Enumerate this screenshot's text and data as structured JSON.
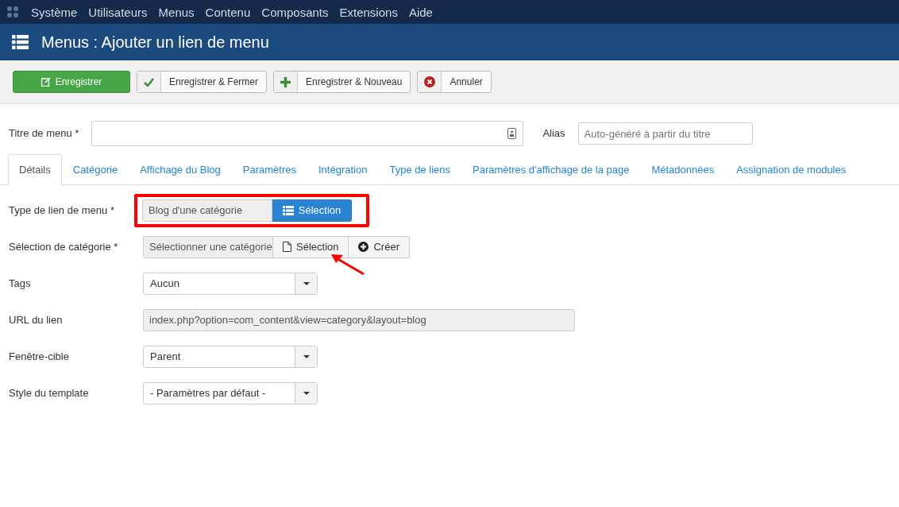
{
  "menubar": [
    "Système",
    "Utilisateurs",
    "Menus",
    "Contenu",
    "Composants",
    "Extensions",
    "Aide"
  ],
  "header": {
    "title": "Menus : Ajouter un lien de menu"
  },
  "toolbar": [
    {
      "label": "Enregistrer",
      "kind": "primary"
    },
    {
      "label": "Enregistrer & Fermer",
      "kind": "default"
    },
    {
      "label": "Enregistrer & Nouveau",
      "kind": "default"
    },
    {
      "label": "Annuler",
      "kind": "default"
    }
  ],
  "title_field": {
    "label": "Titre de menu *"
  },
  "alias_field": {
    "label": "Alias",
    "placeholder": "Auto-généré à partir du titre"
  },
  "tabs": [
    {
      "label": "Détails",
      "selected": true
    },
    {
      "label": "Catégorie",
      "selected": false
    },
    {
      "label": "Affichage du Blog",
      "selected": false
    },
    {
      "label": "Paramètres",
      "selected": false
    },
    {
      "label": "Intégration",
      "selected": false
    },
    {
      "label": "Type de liens",
      "selected": false
    },
    {
      "label": "Paramètres d'affichage de la page",
      "selected": false
    },
    {
      "label": "Métadonnées",
      "selected": false
    },
    {
      "label": "Assignation de modules",
      "selected": false
    }
  ],
  "fields": [
    {
      "label": "Type de lien de menu *",
      "kind": "modal",
      "value": "Blog d'une catégorie",
      "highlighted": true,
      "arrow": false,
      "buttons": [
        {
          "label": "Sélection",
          "kind": "primary"
        }
      ]
    },
    {
      "label": "Sélection de catégorie *",
      "kind": "modal",
      "value": "Sélectionner une catégorie",
      "highlighted": false,
      "arrow": true,
      "buttons": [
        {
          "label": "Sélection",
          "kind": "default"
        },
        {
          "label": "Créer",
          "kind": "default"
        }
      ]
    },
    {
      "label": "Tags",
      "kind": "select",
      "value": "Aucun"
    },
    {
      "label": "URL du lien",
      "kind": "readonly",
      "value": "index.php?option=com_content&view=category&layout=blog"
    },
    {
      "label": "Fenêtre-cible",
      "kind": "select",
      "value": "Parent"
    },
    {
      "label": "Style du template",
      "kind": "select",
      "value": "- Paramètres par défaut -"
    }
  ]
}
